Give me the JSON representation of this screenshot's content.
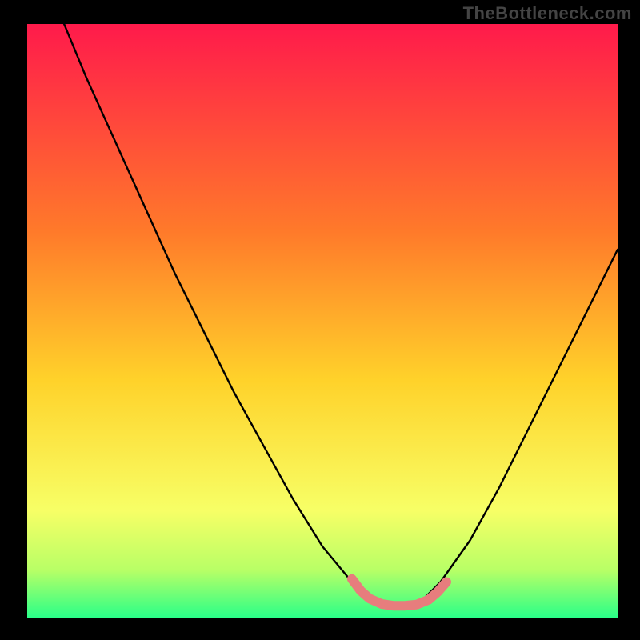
{
  "watermark": "TheBottleneck.com",
  "colors": {
    "frame": "#000000",
    "grad_top": "#ff1a4b",
    "grad_upper_mid": "#ff7a2a",
    "grad_mid": "#ffd22a",
    "grad_lower_mid": "#f7ff66",
    "grad_green1": "#b8ff66",
    "grad_green2": "#2aff88",
    "curve_stroke": "#000000",
    "highlight": "#e77d7d"
  },
  "chart_data": {
    "type": "line",
    "title": "",
    "xlabel": "",
    "ylabel": "",
    "xlim": [
      0,
      100
    ],
    "ylim": [
      0,
      100
    ],
    "series": [
      {
        "name": "bottleneck-curve",
        "x": [
          0,
          5,
          10,
          15,
          20,
          25,
          30,
          35,
          40,
          45,
          50,
          55,
          58,
          61,
          64,
          67,
          70,
          75,
          80,
          85,
          90,
          95,
          100
        ],
        "y": [
          115,
          103,
          91,
          80,
          69,
          58,
          48,
          38,
          29,
          20,
          12,
          6,
          3,
          2,
          2,
          3,
          6,
          13,
          22,
          32,
          42,
          52,
          62
        ]
      },
      {
        "name": "optimal-zone",
        "x": [
          55,
          56.5,
          58,
          60,
          62,
          64,
          66,
          68,
          69.5,
          71
        ],
        "y": [
          6.5,
          4.5,
          3.2,
          2.3,
          2,
          2,
          2.2,
          3.0,
          4.3,
          6.0
        ]
      }
    ],
    "annotations": []
  }
}
